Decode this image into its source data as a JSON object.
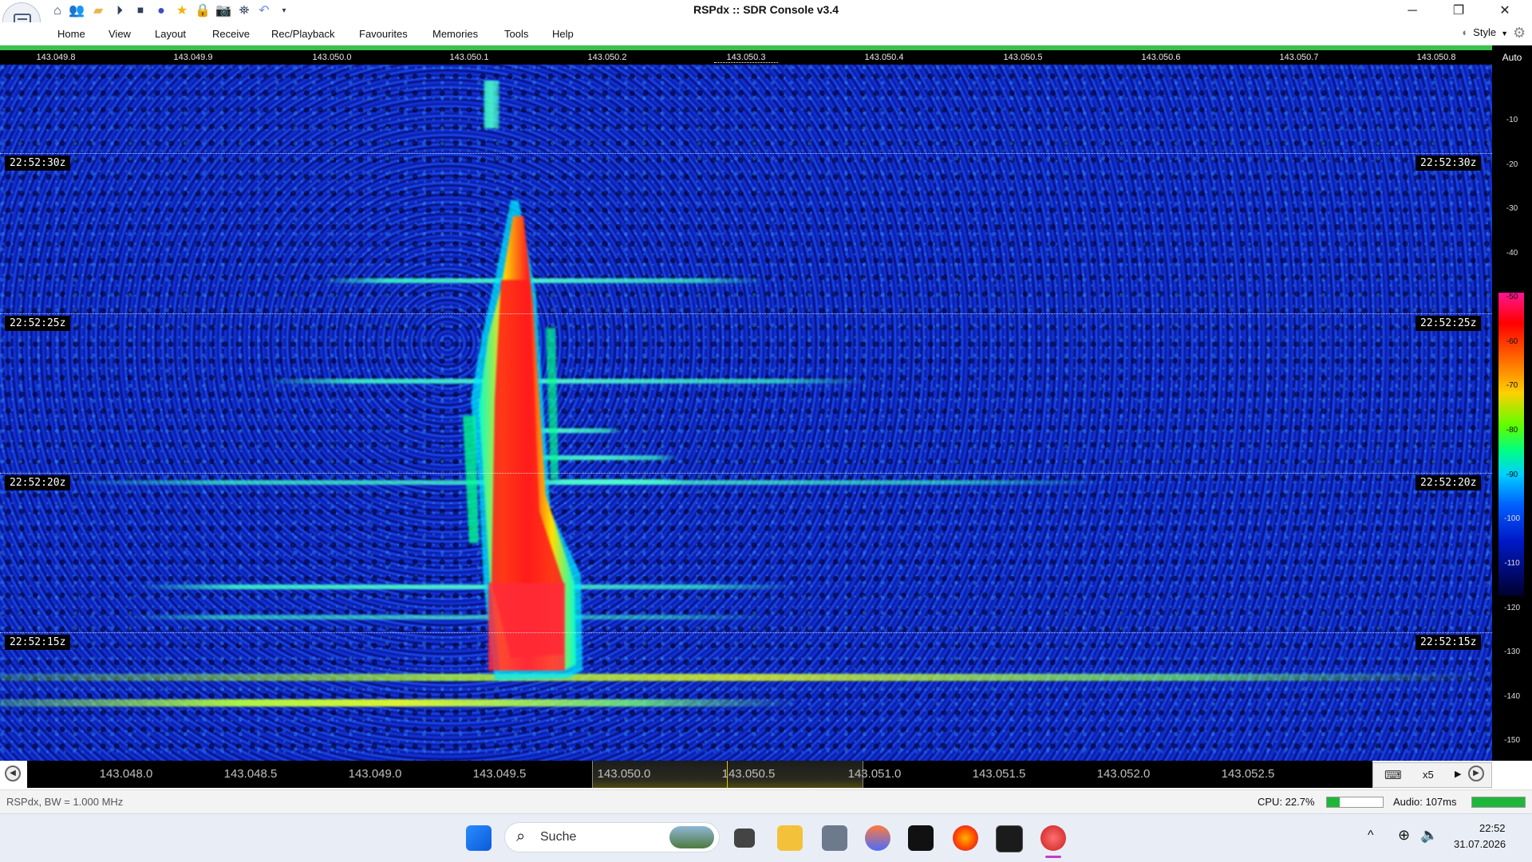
{
  "window": {
    "title": "RSPdx :: SDR Console v3.4",
    "minimize": "─",
    "restore": "❐",
    "close": "✕"
  },
  "quick_access": [
    "home-icon",
    "users-icon",
    "folder-icon",
    "play-icon",
    "stop-icon",
    "record-icon",
    "favourite-star-icon",
    "lock-icon",
    "camera-icon",
    "satellite-icon",
    "undo-icon",
    "more-dropdown-icon"
  ],
  "menu": [
    "Home",
    "View",
    "Layout",
    "Receive",
    "Rec/Playback",
    "Favourites",
    "Memories",
    "Tools",
    "Help"
  ],
  "style_label": "Style",
  "top_scale": {
    "ticks": [
      "143.049.8",
      "143.049.9",
      "143.050.0",
      "143.050.1",
      "143.050.2",
      "143.050.3",
      "143.050.4",
      "143.050.5",
      "143.050.6",
      "143.050.7",
      "143.050.8"
    ]
  },
  "auto_label": "Auto",
  "level_scale": {
    "ticks": [
      "-10",
      "-20",
      "-30",
      "-40",
      "-50",
      "-60",
      "-70",
      "-80",
      "-90",
      "-100",
      "-110",
      "-120",
      "-130",
      "-140",
      "-150"
    ]
  },
  "waterfall": {
    "time_labels": [
      "22:52:30z",
      "22:52:25z",
      "22:52:20z",
      "22:52:15z"
    ]
  },
  "bottom_scale": {
    "ticks": [
      "143.048.0",
      "143.048.5",
      "143.049.0",
      "143.049.5",
      "143.050.0",
      "143.050.5",
      "143.051.0",
      "143.051.5",
      "143.052.0",
      "143.052.5"
    ]
  },
  "zoom": {
    "label": "x5"
  },
  "status": {
    "device": "RSPdx, BW = 1.000 MHz",
    "cpu": "CPU: 22.7%",
    "cpu_percent": 22.7,
    "audio": "Audio: 107ms",
    "audio_fill_percent": 100
  },
  "taskbar": {
    "search_placeholder": "Suche",
    "apps": [
      "windows-start-icon",
      "task-view-icon",
      "file-explorer-icon",
      "satellite-app-icon",
      "flame-app-icon",
      "terminal-icon",
      "firefox-icon",
      "console-icon",
      "sdr-console-icon"
    ],
    "clock_time": "22:52",
    "clock_date": "31.07.2026"
  }
}
